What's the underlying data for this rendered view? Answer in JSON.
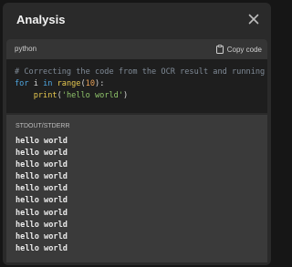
{
  "dialog": {
    "title": "Analysis",
    "close_icon": "close-icon"
  },
  "code_block": {
    "language": "python",
    "copy_label": "Copy code",
    "copy_icon": "clipboard-icon",
    "lines": {
      "comment": "# Correcting the code from the OCR result and running it",
      "for_kw": "for",
      "var": " i ",
      "in_kw": "in",
      "space": " ",
      "range_fn": "range",
      "open_paren": "(",
      "range_arg": "10",
      "close_colon": "):",
      "indent": "    ",
      "print_fn": "print",
      "print_open": "(",
      "print_arg": "'hello world'",
      "print_close": ")"
    }
  },
  "output": {
    "label": "STDOUT/STDERR",
    "lines": [
      "hello world",
      "hello world",
      "hello world",
      "hello world",
      "hello world",
      "hello world",
      "hello world",
      "hello world",
      "hello world",
      "hello world"
    ]
  },
  "colors": {
    "panel_bg": "#2a2a2a",
    "code_bg": "#1e1e1e",
    "keyword": "#4ea6e0",
    "function": "#e6c84f",
    "number": "#e8a055",
    "string": "#8fc46a",
    "comment": "#7f8a96"
  }
}
